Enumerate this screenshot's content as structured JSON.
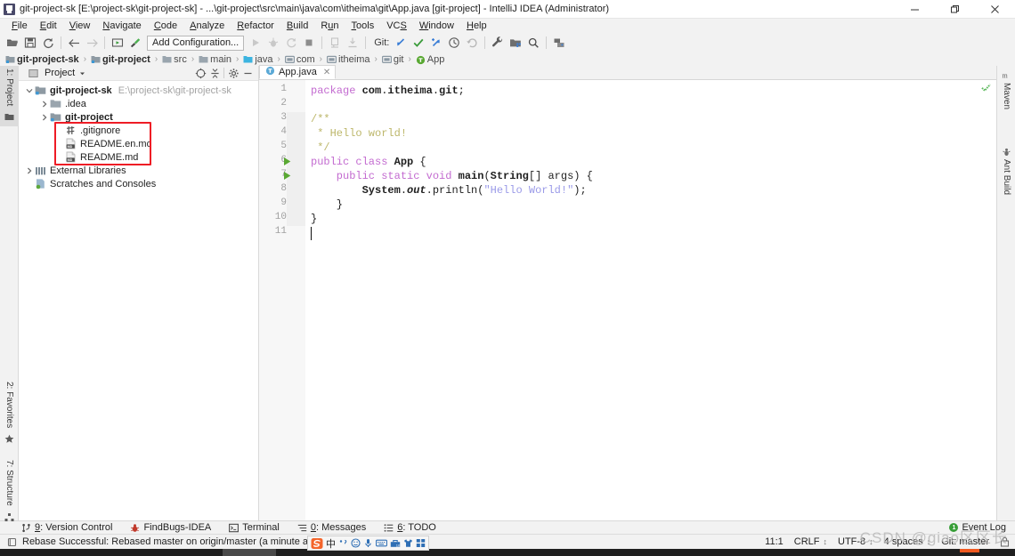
{
  "window": {
    "title": "git-project-sk [E:\\project-sk\\git-project-sk] - ...\\git-project\\src\\main\\java\\com\\itheima\\git\\App.java [git-project] - IntelliJ IDEA (Administrator)",
    "minimize_label": "—",
    "maximize_label": "❐",
    "close_label": "✕"
  },
  "menubar": {
    "items": [
      {
        "label": "File",
        "mnemonic": "F"
      },
      {
        "label": "Edit",
        "mnemonic": "E"
      },
      {
        "label": "View",
        "mnemonic": "V"
      },
      {
        "label": "Navigate",
        "mnemonic": "N"
      },
      {
        "label": "Code",
        "mnemonic": "C"
      },
      {
        "label": "Analyze",
        "mnemonic": "A"
      },
      {
        "label": "Refactor",
        "mnemonic": "R"
      },
      {
        "label": "Build",
        "mnemonic": "B"
      },
      {
        "label": "Run",
        "mnemonic": "u"
      },
      {
        "label": "Tools",
        "mnemonic": "T"
      },
      {
        "label": "VCS",
        "mnemonic": "S"
      },
      {
        "label": "Window",
        "mnemonic": "W"
      },
      {
        "label": "Help",
        "mnemonic": "H"
      }
    ]
  },
  "toolbar": {
    "open_icon": "folder-open-icon",
    "save_icon": "save-icon",
    "sync_icon": "sync-icon",
    "back_icon": "arrow-left-icon",
    "forward_icon": "arrow-right-icon",
    "run_config_icon": "run-config-icon",
    "build_icon": "hammer-icon",
    "config_label": "Add Configuration...",
    "run_icon": "run-play-icon",
    "debug_icon": "debug-bug-icon",
    "run_coverage_icon": "run-coverage-icon",
    "stop_icon": "stop-square-icon",
    "profile_icon": "profile-icon",
    "attach_icon": "attach-process-icon",
    "git_label": "Git:",
    "git_update_icon": "git-update-icon",
    "git_commit_icon": "git-commit-check-icon",
    "git_push_icon": "git-push-icon",
    "git_history_icon": "git-history-clock-icon",
    "git_rollback_icon": "git-rollback-icon",
    "settings_icon": "wrench-settings-icon",
    "project-structure_icon": "project-structure-icon",
    "search_icon": "search-magnifier-icon",
    "plugins_icon": "plugins-icon"
  },
  "breadcrumb": {
    "items": [
      {
        "label": "git-project-sk",
        "type": "module",
        "bold": true
      },
      {
        "label": "git-project",
        "type": "module",
        "bold": true
      },
      {
        "label": "src",
        "type": "folder",
        "bold": false
      },
      {
        "label": "main",
        "type": "folder",
        "bold": false
      },
      {
        "label": "java",
        "type": "source-folder",
        "bold": false
      },
      {
        "label": "com",
        "type": "package",
        "bold": false
      },
      {
        "label": "itheima",
        "type": "package",
        "bold": false
      },
      {
        "label": "git",
        "type": "package",
        "bold": false
      },
      {
        "label": "App",
        "type": "class",
        "bold": false
      }
    ],
    "separator": "›"
  },
  "left_strip": {
    "tabs": [
      {
        "label": "1: Project",
        "mnemonic": "1",
        "icon": "project-icon",
        "selected": true
      },
      {
        "label": "2: Favorites",
        "mnemonic": "2",
        "icon": "favorites-star-icon",
        "selected": false
      },
      {
        "label": "7: Structure",
        "mnemonic": "7",
        "icon": "structure-icon",
        "selected": false
      }
    ]
  },
  "right_strip": {
    "tabs": [
      {
        "label": "Maven",
        "icon": "maven-icon"
      },
      {
        "label": "Ant Build",
        "icon": "ant-build-icon"
      }
    ]
  },
  "project_panel": {
    "title": "Project",
    "dropdown_icon": "chevron-down-icon",
    "panel_icon": "project-panel-icon",
    "locate_icon": "target-locate-icon",
    "collapse_icon": "collapse-all-icon",
    "settings_icon": "gear-icon",
    "hide_icon": "hide-minimize-icon",
    "tree": [
      {
        "label": "git-project-sk",
        "path": "E:\\project-sk\\git-project-sk",
        "icon": "module-icon",
        "indent": 0,
        "arrow": "down",
        "bold": true,
        "highlighted": false
      },
      {
        "label": ".idea",
        "path": "",
        "icon": "folder-icon",
        "indent": 1,
        "arrow": "right",
        "bold": false,
        "highlighted": false
      },
      {
        "label": "git-project",
        "path": "",
        "icon": "module-icon",
        "indent": 1,
        "arrow": "right",
        "bold": true,
        "highlighted": false
      },
      {
        "label": ".gitignore",
        "path": "",
        "icon": "gitignore-file-icon",
        "indent": 2,
        "arrow": "none",
        "bold": false,
        "highlighted": true
      },
      {
        "label": "README.en.md",
        "path": "",
        "icon": "markdown-file-icon",
        "indent": 2,
        "arrow": "none",
        "bold": false,
        "highlighted": true
      },
      {
        "label": "README.md",
        "path": "",
        "icon": "markdown-file-icon",
        "indent": 2,
        "arrow": "none",
        "bold": false,
        "highlighted": true
      },
      {
        "label": "External Libraries",
        "path": "",
        "icon": "external-libraries-icon",
        "indent": 0,
        "arrow": "right",
        "bold": false,
        "highlighted": false
      },
      {
        "label": "Scratches and Consoles",
        "path": "",
        "icon": "scratches-icon",
        "indent": 0,
        "arrow": "none",
        "bold": false,
        "highlighted": false
      }
    ],
    "highlight_color": "#ee1c25"
  },
  "editor": {
    "tab": {
      "label": "App.java",
      "icon": "java-class-icon",
      "close_label": "✕"
    },
    "inspection_status": "ok",
    "lines": [
      {
        "n": "1",
        "gutter": "",
        "tokens": [
          {
            "t": "package ",
            "c": "kw"
          },
          {
            "t": "com",
            "c": "cls"
          },
          {
            "t": ".",
            "c": "plain"
          },
          {
            "t": "itheima",
            "c": "cls"
          },
          {
            "t": ".",
            "c": "plain"
          },
          {
            "t": "git",
            "c": "cls"
          },
          {
            "t": ";",
            "c": "plain"
          }
        ]
      },
      {
        "n": "2",
        "gutter": "",
        "tokens": []
      },
      {
        "n": "3",
        "gutter": "",
        "tokens": [
          {
            "t": "/**",
            "c": "cmt"
          }
        ]
      },
      {
        "n": "4",
        "gutter": "",
        "tokens": [
          {
            "t": " * Hello world!",
            "c": "cmt"
          }
        ]
      },
      {
        "n": "5",
        "gutter": "",
        "tokens": [
          {
            "t": " */",
            "c": "cmt"
          }
        ]
      },
      {
        "n": "6",
        "gutter": "run",
        "tokens": [
          {
            "t": "public class ",
            "c": "kw"
          },
          {
            "t": "App",
            "c": "cls"
          },
          {
            "t": " {",
            "c": "plain"
          }
        ]
      },
      {
        "n": "7",
        "gutter": "run",
        "tokens": [
          {
            "t": "    public static void ",
            "c": "kw"
          },
          {
            "t": "main",
            "c": "cls"
          },
          {
            "t": "(",
            "c": "plain"
          },
          {
            "t": "String",
            "c": "cls"
          },
          {
            "t": "[] args) {",
            "c": "plain"
          }
        ]
      },
      {
        "n": "8",
        "gutter": "",
        "tokens": [
          {
            "t": "        System",
            "c": "cls"
          },
          {
            "t": ".",
            "c": "plain"
          },
          {
            "t": "out",
            "c": "fld"
          },
          {
            "t": ".println(",
            "c": "plain"
          },
          {
            "t": "\"Hello World!\"",
            "c": "str"
          },
          {
            "t": ");",
            "c": "plain"
          }
        ]
      },
      {
        "n": "9",
        "gutter": "",
        "tokens": [
          {
            "t": "    }",
            "c": "plain"
          }
        ]
      },
      {
        "n": "10",
        "gutter": "",
        "tokens": [
          {
            "t": "}",
            "c": "plain"
          }
        ]
      },
      {
        "n": "11",
        "gutter": "",
        "tokens": []
      }
    ]
  },
  "bottom_bar": {
    "tabs": [
      {
        "label": "9: Version Control",
        "mnemonic": "9",
        "icon": "version-control-icon"
      },
      {
        "label": "FindBugs-IDEA",
        "mnemonic": "",
        "icon": "findbugs-icon"
      },
      {
        "label": "Terminal",
        "mnemonic": "",
        "icon": "terminal-icon"
      },
      {
        "label": "0: Messages",
        "mnemonic": "0",
        "icon": "messages-icon"
      },
      {
        "label": "6: TODO",
        "mnemonic": "6",
        "icon": "todo-icon"
      }
    ],
    "event_log": {
      "label": "Event Log",
      "count": "1",
      "badge_color": "#389e38"
    }
  },
  "status_bar": {
    "message_icon": "status-message-icon",
    "message": "Rebase Successful: Rebased master on origin/master (a minute ago)",
    "caret_position": "11:1",
    "line_separator": "CRLF",
    "encoding": "UTF-8",
    "indent": "4 spaces",
    "branch": "Git: master",
    "separator": "↕",
    "lock_icon": "read-only-lock-icon"
  },
  "ime_bar": {
    "logo": "sogou-logo-icon",
    "mode_label": "中",
    "punctuation_icon": "punctuation-icon",
    "emoji_icon": "emoji-smile-icon",
    "voice_icon": "microphone-icon",
    "keyboard_icon": "soft-keyboard-icon",
    "toolbox_icon": "toolbox-icon",
    "skin_icon": "skin-shirt-icon",
    "apps_icon": "apps-grid-icon"
  },
  "watermark": {
    "text": "CSDN @giao区区长"
  }
}
